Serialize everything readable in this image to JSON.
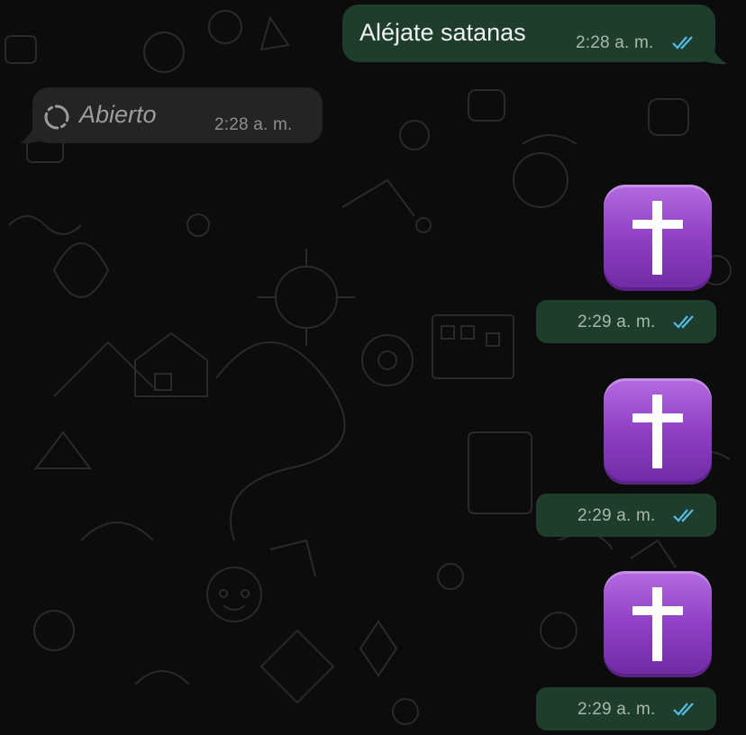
{
  "messages": [
    {
      "type": "text",
      "direction": "outgoing",
      "text": "Aléjate satanas",
      "time": "2:28 a. m.",
      "status": "read-double-check-icon"
    },
    {
      "type": "voice-status",
      "direction": "incoming",
      "icon": "open-ring-icon",
      "text": "Abierto",
      "time": "2:28 a. m."
    },
    {
      "type": "emoji",
      "direction": "outgoing",
      "emoji": "latin-cross-emoji",
      "time": "2:29 a. m.",
      "status": "read-double-check-icon"
    },
    {
      "type": "emoji",
      "direction": "outgoing",
      "emoji": "latin-cross-emoji",
      "time": "2:29 a. m.",
      "status": "read-double-check-icon"
    },
    {
      "type": "emoji",
      "direction": "outgoing",
      "emoji": "latin-cross-emoji",
      "time": "2:29 a. m.",
      "status": "read-double-check-icon"
    }
  ],
  "colors": {
    "background": "#0c0c0c",
    "outgoing_bubble": "#1f3d2c",
    "incoming_bubble": "#232423",
    "read_ticks": "#53bdeb",
    "emoji_purple": "#8f3fc4"
  }
}
